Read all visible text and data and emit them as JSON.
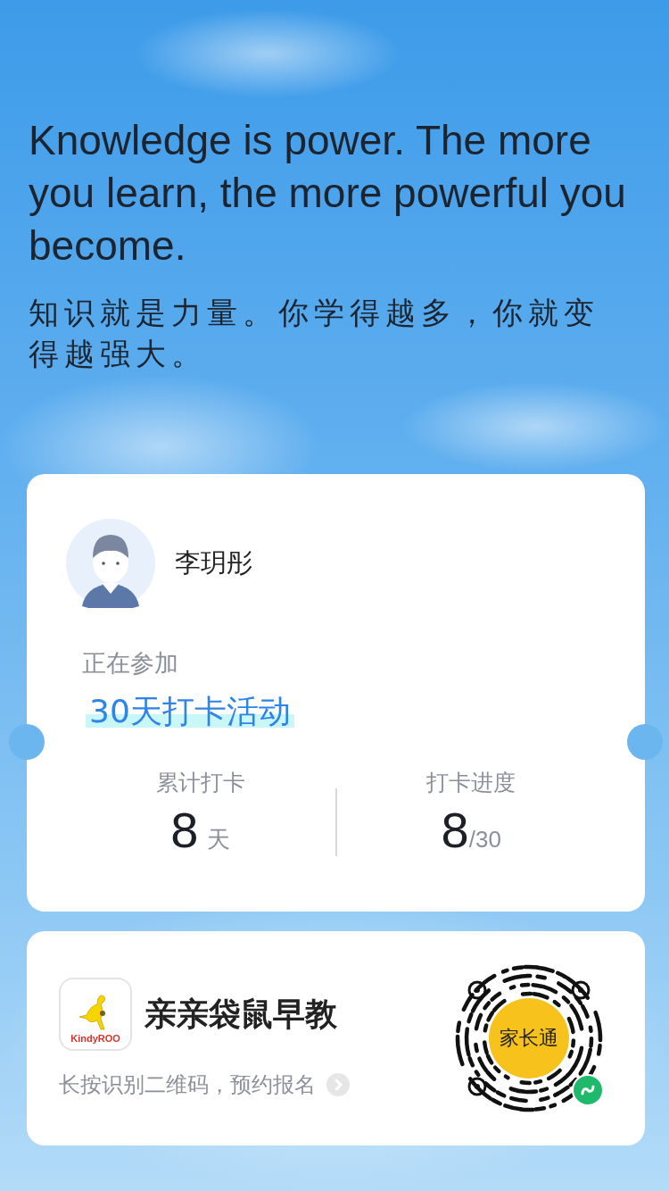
{
  "quote": {
    "en": "Knowledge is power. The more you learn, the more powerful you become.",
    "zh": "知识就是力量。你学得越多，你就变得越强大。"
  },
  "profile": {
    "name": "李玥彤"
  },
  "activity": {
    "label": "正在参加",
    "title": "30天打卡活动"
  },
  "stats": [
    {
      "label": "累计打卡",
      "value": "8",
      "unit": "天"
    },
    {
      "label": "打卡进度",
      "value": "8",
      "unit": "/30"
    }
  ],
  "promo": {
    "logo_text": "KindyROO",
    "name": "亲亲袋鼠早教",
    "hint": "长按识别二维码，预约报名",
    "qr_label": "家长通"
  }
}
